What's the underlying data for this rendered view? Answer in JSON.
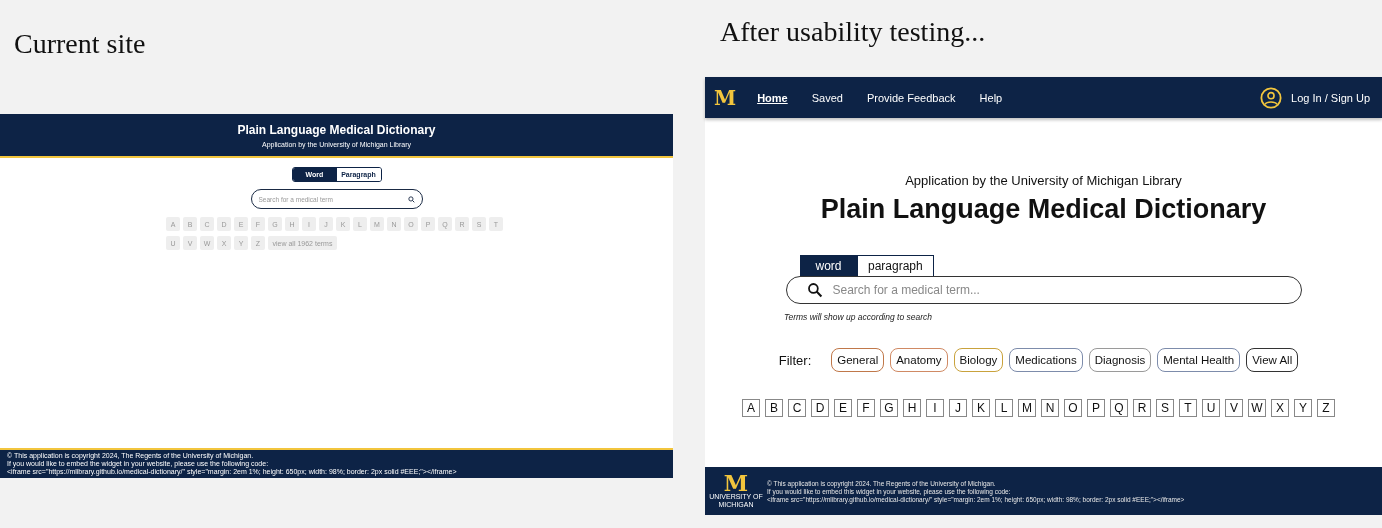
{
  "current_site": {
    "caption": "Current site",
    "header": {
      "title": "Plain Language Medical Dictionary",
      "subtitle": "Application by the University of Michigan Library"
    },
    "mode_toggle": [
      {
        "label": "Word",
        "selected": true
      },
      {
        "label": "Paragraph",
        "selected": false
      }
    ],
    "search": {
      "placeholder": "Search for a medical term"
    },
    "letters": [
      "A",
      "B",
      "C",
      "D",
      "E",
      "F",
      "G",
      "H",
      "I",
      "J",
      "K",
      "L",
      "M",
      "N",
      "O",
      "P",
      "Q",
      "R",
      "S",
      "T",
      "U",
      "V",
      "W",
      "X",
      "Y",
      "Z"
    ],
    "view_all": "view all 1962 terms",
    "footer": [
      "© This application is copyright 2024, The Regents of the University of Michigan.",
      "If you would like to embed the widget in your website, please use the following code:",
      "<iframe src=\"https://mlibrary.github.io/medical-dictionary/\" style=\"margin: 2em 1%; height: 650px; width: 98%; border: 2px solid #EEE;\"></iframe>"
    ]
  },
  "redesign": {
    "caption": "After usability testing...",
    "nav": {
      "logo": "M",
      "items": [
        {
          "label": "Home",
          "selected": true
        },
        {
          "label": "Saved",
          "selected": false
        },
        {
          "label": "Provide Feedback",
          "selected": false
        },
        {
          "label": "Help",
          "selected": false
        }
      ],
      "login": "Log In / Sign Up"
    },
    "subtitle": "Application by the University of Michigan Library",
    "title": "Plain Language Medical Dictionary",
    "mode_tabs": [
      {
        "label": "word",
        "selected": true
      },
      {
        "label": "paragraph",
        "selected": false
      }
    ],
    "search": {
      "placeholder": "Search for a medical term..."
    },
    "hint": "Terms will show up according to search",
    "filter_label": "Filter:",
    "filters": [
      {
        "label": "General",
        "color": "#c0784a"
      },
      {
        "label": "Anatomy",
        "color": "#d08a64"
      },
      {
        "label": "Biology",
        "color": "#c9a23c"
      },
      {
        "label": "Medications",
        "color": "#7d8cab"
      },
      {
        "label": "Diagnosis",
        "color": "#9a9a9a"
      },
      {
        "label": "Mental Health",
        "color": "#7d8cab"
      },
      {
        "label": "View All",
        "color": "#333333"
      }
    ],
    "letters": [
      "A",
      "B",
      "C",
      "D",
      "E",
      "F",
      "G",
      "H",
      "I",
      "J",
      "K",
      "L",
      "M",
      "N",
      "O",
      "P",
      "Q",
      "R",
      "S",
      "T",
      "U",
      "V",
      "W",
      "X",
      "Y",
      "Z"
    ],
    "footer": {
      "logo_letter": "M",
      "logo_caption": [
        "UNIVERSITY OF",
        "MICHIGAN"
      ],
      "lines": [
        "© This application is copyright 2024. The Regents of the University of Michigan.",
        "If you would like to embed this widget in your website, please use the following code:",
        "<iframe src=\"https://mlibrary.github.io/medical-dictionary/\" style=\"margin: 2em 1%; height: 650px; width: 98%; border: 2px solid #EEE;\"></iframe>"
      ]
    }
  }
}
